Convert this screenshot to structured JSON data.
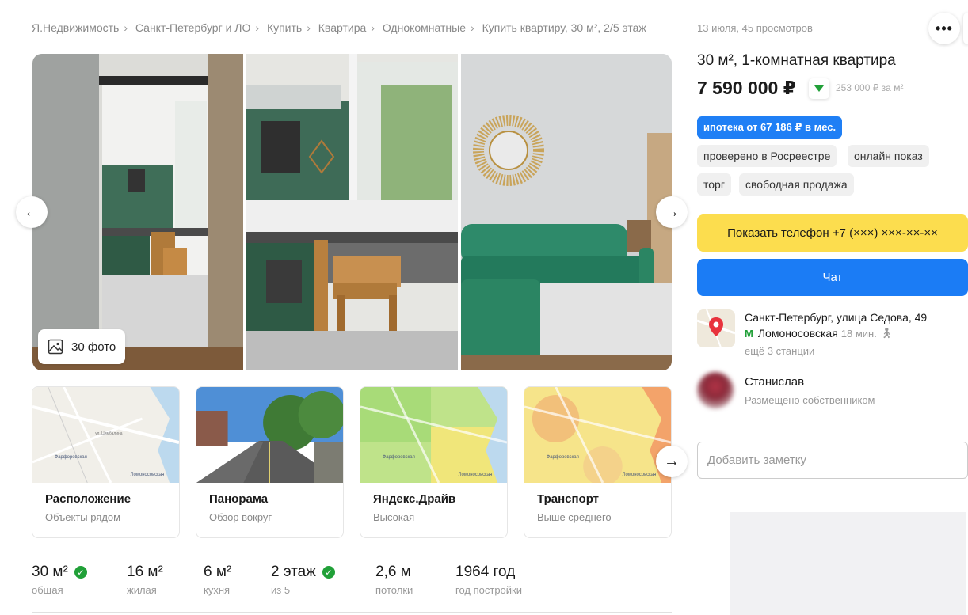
{
  "breadcrumbs": [
    "Я.Недвижимость",
    "Санкт-Петербург и ЛО",
    "Купить",
    "Квартира",
    "Однокомнатные",
    "Купить квартиру, 30 м², 2/5 этаж"
  ],
  "gallery": {
    "photo_count_label": "30 фото",
    "icons": {
      "prev": "arrow-left-icon",
      "next": "arrow-right-icon",
      "photos": "image-icon"
    }
  },
  "cards": [
    {
      "title": "Расположение",
      "subtitle": "Объекты рядом"
    },
    {
      "title": "Панорама",
      "subtitle": "Обзор вокруг"
    },
    {
      "title": "Яндекс.Драйв",
      "subtitle": "Высокая"
    },
    {
      "title": "Транспорт",
      "subtitle": "Выше среднего"
    }
  ],
  "map_labels": {
    "street": "ул. Цимбалина",
    "station": "Фарфоровская",
    "metro": "Ломоносовская"
  },
  "params": [
    {
      "value": "30 м²",
      "label": "общая",
      "verified": true
    },
    {
      "value": "16 м²",
      "label": "жилая",
      "verified": false
    },
    {
      "value": "6 м²",
      "label": "кухня",
      "verified": false
    },
    {
      "value": "2 этаж",
      "label": "из 5",
      "verified": true
    },
    {
      "value": "2,6 м",
      "label": "потолки",
      "verified": false
    },
    {
      "value": "1964 год",
      "label": "год постройки",
      "verified": false
    }
  ],
  "sidebar": {
    "meta": "13 июля, 45 просмотров",
    "more_icon": "more-dots-icon",
    "title": "30 м², 1-комнатная квартира",
    "price": "7 590 000 ₽",
    "price_per_m2": "253 000 ₽ за м²",
    "mortgage": "ипотека от 67 186 ₽ в мес.",
    "tags": [
      "проверено в Росреестре",
      "онлайн показ",
      "торг",
      "свободная продажа"
    ],
    "phone_button": "Показать телефон +7 (×××) ×××-××-××",
    "chat_button": "Чат",
    "address": "Санкт-Петербург, улица Седова, 49",
    "metro_station": "Ломоносовская",
    "metro_time": "18 мин.",
    "more_stations": "ещё 3 станции",
    "seller_name": "Станислав",
    "seller_type": "Размещено собственником",
    "note_placeholder": "Добавить заметку"
  },
  "colors": {
    "accent_yellow": "#fcdd4e",
    "accent_blue": "#1b7cf5",
    "verified_green": "#21a038"
  }
}
